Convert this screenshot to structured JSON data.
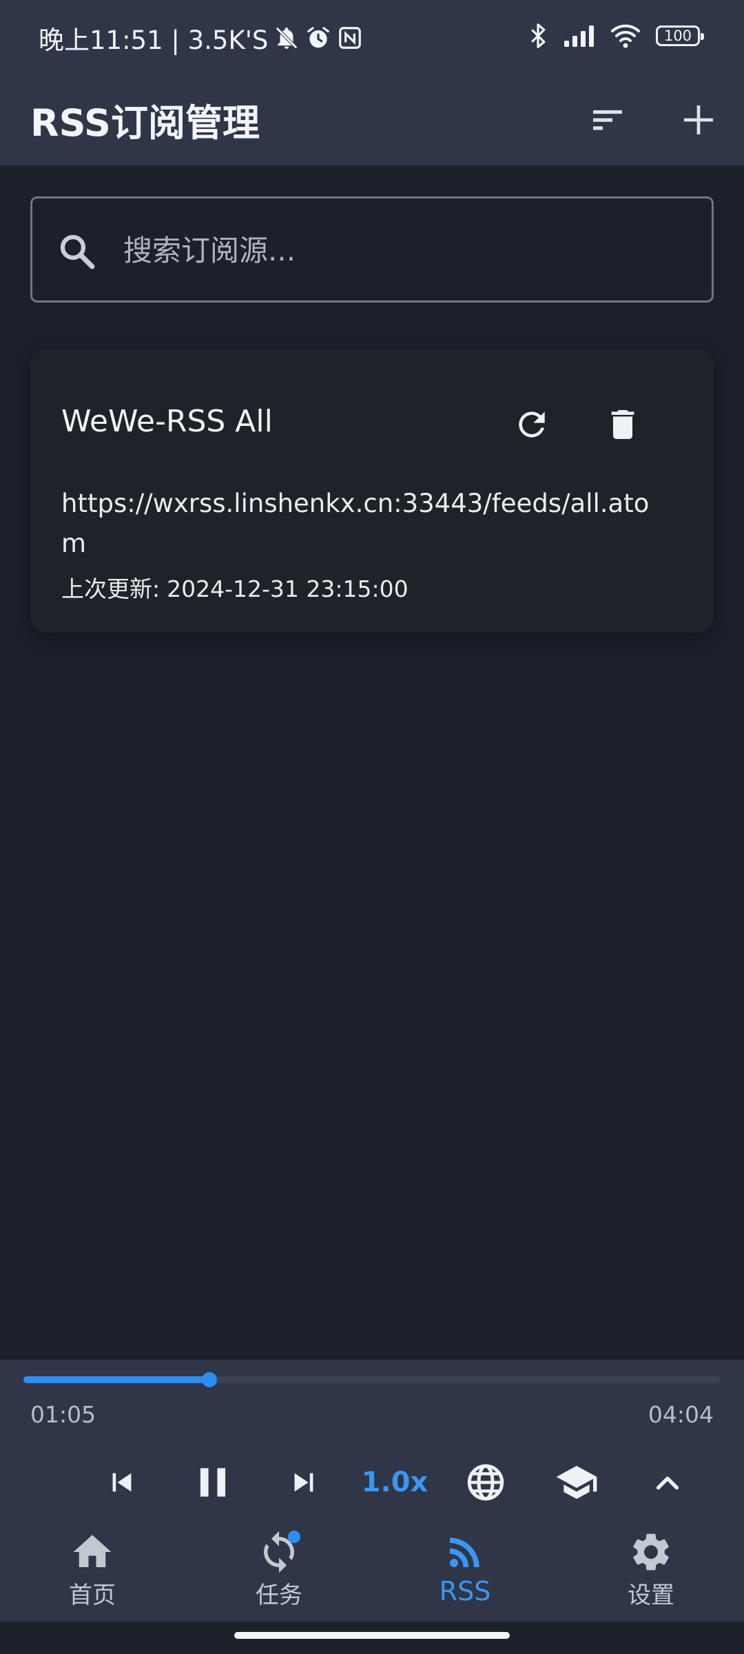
{
  "status_bar": {
    "left_text": "晚上11:51 | 3.5K'S",
    "battery": "100"
  },
  "app_bar": {
    "title": "RSS订阅管理",
    "icons": [
      "sort-icon",
      "add-icon"
    ]
  },
  "search": {
    "placeholder": "搜索订阅源..."
  },
  "feeds": [
    {
      "title": "WeWe-RSS All",
      "url": "https://wxrss.linshenkx.cn:33443/feeds/all.atom",
      "updated_label": "上次更新:",
      "updated_value": "2024-12-31 23:15:00"
    }
  ],
  "player": {
    "current_time": "01:05",
    "total_time": "04:04",
    "progress_fraction": 0.2664,
    "speed": "1.0x",
    "accent_color": "#2e8ef0"
  },
  "bottom_nav": {
    "items": [
      {
        "label": "首页",
        "icon": "home-icon",
        "active": false
      },
      {
        "label": "任务",
        "icon": "sync-icon",
        "active": false,
        "badge": true
      },
      {
        "label": "RSS",
        "icon": "rss-icon",
        "active": true
      },
      {
        "label": "设置",
        "icon": "gear-icon",
        "active": false
      }
    ]
  }
}
